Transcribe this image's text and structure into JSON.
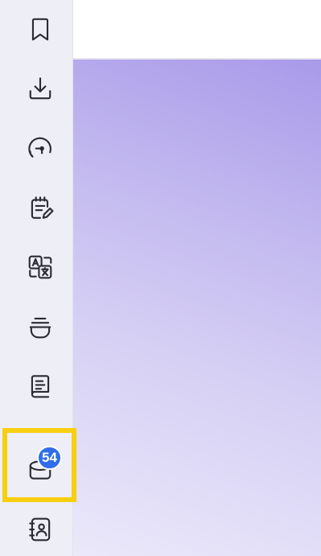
{
  "sidebar": {
    "items": [
      {
        "name": "bookmark",
        "icon": "bookmark-icon"
      },
      {
        "name": "download",
        "icon": "download-icon"
      },
      {
        "name": "gauge",
        "icon": "gauge-icon"
      },
      {
        "name": "notes",
        "icon": "clipboard-edit-icon"
      },
      {
        "name": "translate",
        "icon": "translate-icon"
      },
      {
        "name": "bowl",
        "icon": "bowl-icon"
      },
      {
        "name": "book",
        "icon": "book-icon"
      },
      {
        "name": "inbox",
        "icon": "inbox-icon",
        "badge": "54",
        "highlighted": true
      },
      {
        "name": "contacts",
        "icon": "contacts-book-icon"
      }
    ]
  },
  "colors": {
    "sidebar_bg": "#eeeef6",
    "icon_stroke": "#2b2b33",
    "badge_bg": "#2f6ee6",
    "highlight": "#f7cf0f",
    "gradient_top": "#a99ae9",
    "gradient_bottom": "#ebe8fa"
  }
}
